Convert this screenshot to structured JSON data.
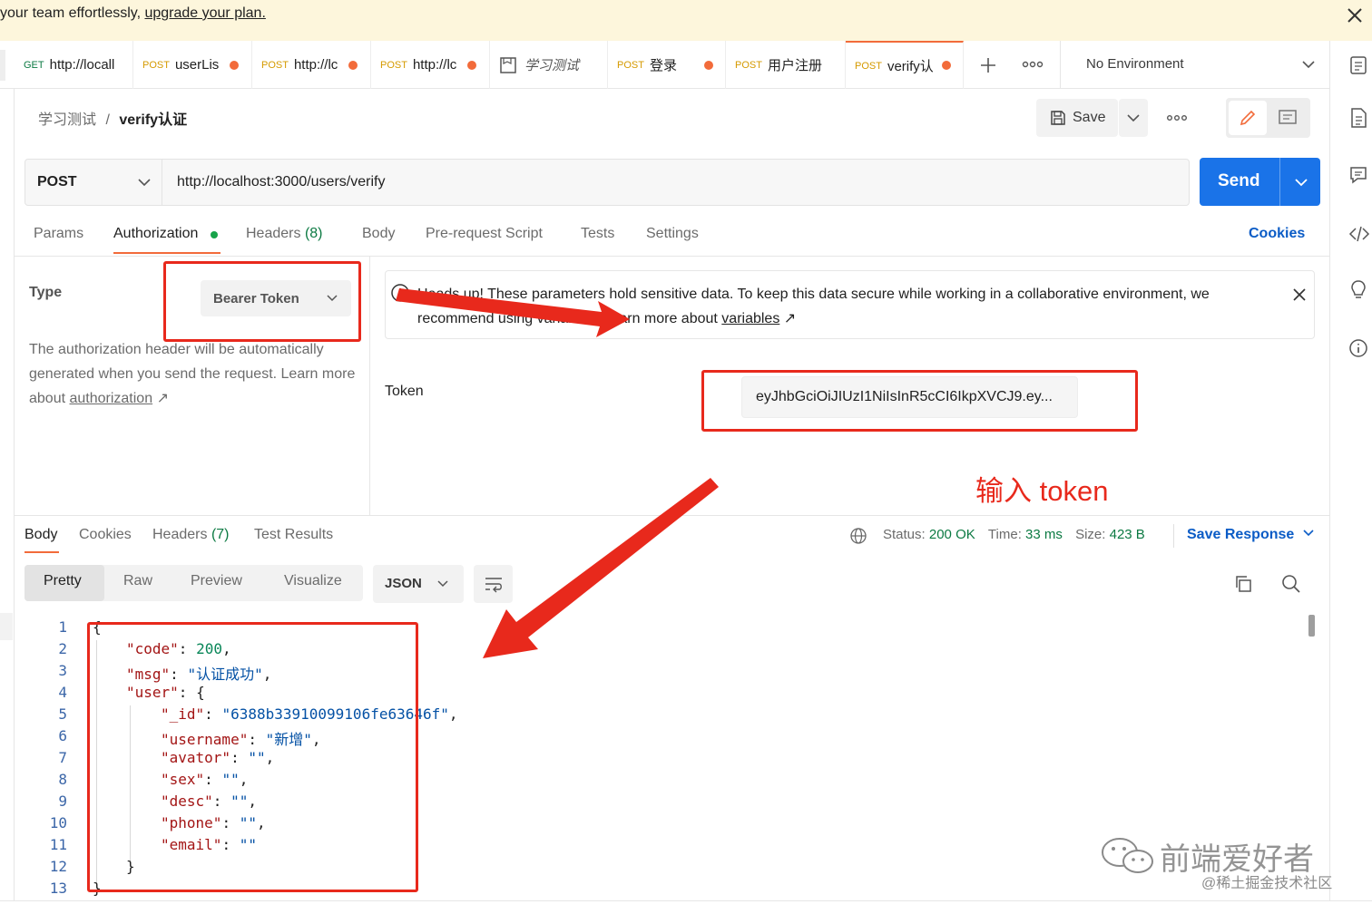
{
  "banner": {
    "text": "your team effortlessly, ",
    "link": "upgrade your plan."
  },
  "tabs": [
    {
      "method": "GET",
      "label": "http://locall",
      "dirty": false
    },
    {
      "method": "POST",
      "label": "userLis",
      "dirty": true
    },
    {
      "method": "POST",
      "label": "http://lc",
      "dirty": true
    },
    {
      "method": "POST",
      "label": "http://lc",
      "dirty": true
    },
    {
      "method": "",
      "label": "学习测试",
      "dirty": false
    },
    {
      "method": "POST",
      "label": "登录",
      "dirty": true
    },
    {
      "method": "POST",
      "label": "用户注册",
      "dirty": false
    },
    {
      "method": "POST",
      "label": "verify认",
      "dirty": true
    }
  ],
  "environment": "No Environment",
  "breadcrumb": {
    "parent": "学习测试",
    "separator": "/",
    "current": "verify认证"
  },
  "toolbar": {
    "save_label": "Save"
  },
  "request": {
    "method": "POST",
    "url": "http://localhost:3000/users/verify",
    "send_label": "Send"
  },
  "request_tabs": {
    "params": "Params",
    "authorization": "Authorization",
    "headers": "Headers",
    "headers_count": "(8)",
    "body": "Body",
    "prerequest": "Pre-request Script",
    "tests": "Tests",
    "settings": "Settings",
    "cookies": "Cookies"
  },
  "auth": {
    "type_label": "Type",
    "type_value": "Bearer Token",
    "desc_prefix": "The authorization header will be automatically generated when you send the request. Learn more about ",
    "desc_link": "authorization",
    "desc_arrow": "↗",
    "notice_text": "Heads up! These parameters hold sensitive data. To keep this data secure while working in a collaborative environment, we recommend using variables. Learn more about ",
    "notice_link": "variables",
    "notice_arrow": "↗",
    "token_label": "Token",
    "token_value": "eyJhbGciOiJIUzI1NiIsInR5cCI6IkpXVCJ9.ey..."
  },
  "response_tabs": {
    "body": "Body",
    "cookies": "Cookies",
    "headers": "Headers",
    "headers_count": "(7)",
    "test_results": "Test Results"
  },
  "response_status": {
    "status_label": "Status:",
    "status_value": "200 OK",
    "time_label": "Time:",
    "time_value": "33 ms",
    "size_label": "Size:",
    "size_value": "423 B",
    "save_response": "Save Response"
  },
  "view_options": {
    "pretty": "Pretty",
    "raw": "Raw",
    "preview": "Preview",
    "visualize": "Visualize",
    "format": "JSON"
  },
  "response_body": {
    "line_numbers": [
      "1",
      "2",
      "3",
      "4",
      "5",
      "6",
      "7",
      "8",
      "9",
      "10",
      "11",
      "12",
      "13"
    ],
    "open_brace": "{",
    "close_brace": "}",
    "inner_close": "}",
    "lines": [
      {
        "key": "\"code\"",
        "value": "200",
        "type": "number",
        "comma": ","
      },
      {
        "key": "\"msg\"",
        "value": "\"认证成功\"",
        "type": "string",
        "comma": ","
      },
      {
        "key": "\"user\"",
        "value": "{",
        "type": "plain",
        "comma": ""
      },
      {
        "key": "\"_id\"",
        "value": "\"6388b33910099106fe63646f\"",
        "type": "string",
        "comma": ","
      },
      {
        "key": "\"username\"",
        "value": "\"新增\"",
        "type": "string",
        "comma": ","
      },
      {
        "key": "\"avator\"",
        "value": "\"\"",
        "type": "string",
        "comma": ","
      },
      {
        "key": "\"sex\"",
        "value": "\"\"",
        "type": "string",
        "comma": ","
      },
      {
        "key": "\"desc\"",
        "value": "\"\"",
        "type": "string",
        "comma": ","
      },
      {
        "key": "\"phone\"",
        "value": "\"\"",
        "type": "string",
        "comma": ","
      },
      {
        "key": "\"email\"",
        "value": "\"\"",
        "type": "string",
        "comma": ""
      }
    ]
  },
  "annotation": {
    "text": "输入 token"
  },
  "watermark": {
    "main": "前端爱好者",
    "sub": "@稀土掘金技术社区"
  },
  "colors": {
    "accent": "#f26b3a",
    "send": "#1a73e8",
    "annotation": "#e8291c",
    "status_ok": "#0c7a43"
  }
}
